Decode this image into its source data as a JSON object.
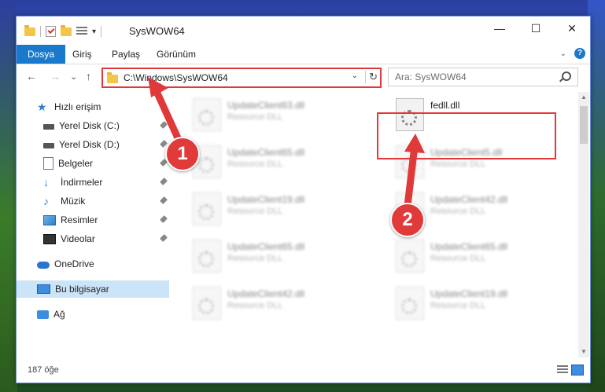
{
  "window": {
    "title": "SysWOW64",
    "controls": [
      "—",
      "☐",
      "✕"
    ]
  },
  "ribbon": {
    "tabs": [
      "Dosya",
      "Giriş",
      "Paylaş",
      "Görünüm"
    ]
  },
  "nav": {
    "back": "←",
    "forward": "→",
    "recent": "⌄",
    "up": "↑",
    "address": "C:\\Windows\\SysWOW64",
    "address_dropdown": "⌄",
    "refresh": "↻",
    "search_placeholder": "Ara: SysWOW64"
  },
  "sidebar": {
    "items": [
      {
        "label": "Hızlı erişim",
        "icon": "star-icon"
      },
      {
        "label": "Yerel Disk (C:)",
        "icon": "disk-icon",
        "pinned": true
      },
      {
        "label": "Yerel Disk (D:)",
        "icon": "disk-icon",
        "pinned": true
      },
      {
        "label": "Belgeler",
        "icon": "document-icon",
        "pinned": true
      },
      {
        "label": "İndirmeler",
        "icon": "download-icon",
        "pinned": true
      },
      {
        "label": "Müzik",
        "icon": "music-icon",
        "pinned": true
      },
      {
        "label": "Resimler",
        "icon": "pictures-icon",
        "pinned": true
      },
      {
        "label": "Videolar",
        "icon": "video-icon",
        "pinned": true
      },
      {
        "label": "OneDrive",
        "icon": "cloud-icon"
      },
      {
        "label": "Bu bilgisayar",
        "icon": "computer-icon",
        "selected": true
      },
      {
        "label": "Ağ",
        "icon": "network-icon"
      }
    ]
  },
  "files": {
    "left_column": [
      {
        "name": "UpdateClient63.dll",
        "type": "Resource DLL"
      },
      {
        "name": "UpdateClient65.dll",
        "type": "Resource DLL"
      },
      {
        "name": "UpdateClient19.dll",
        "type": "Resource DLL"
      },
      {
        "name": "UpdateClient65.dll",
        "type": "Resource DLL"
      },
      {
        "name": "UpdateClient42.dll",
        "type": "Resource DLL"
      }
    ],
    "right_column": [
      {
        "name": "fedll.dll",
        "type": ""
      },
      {
        "name": "UpdateClient5.dll",
        "type": "Resource DLL"
      },
      {
        "name": "UpdateClient42.dll",
        "type": "Resource DLL"
      },
      {
        "name": "UpdateClient65.dll",
        "type": "Resource DLL"
      },
      {
        "name": "UpdateClient19.dll",
        "type": "Resource DLL"
      }
    ]
  },
  "status": {
    "item_count": "187 öğe"
  },
  "annotations": {
    "badge1": "1",
    "badge2": "2",
    "color": "#e0393a"
  },
  "colors": {
    "accent": "#1979ca",
    "selection": "#cce4f7"
  }
}
